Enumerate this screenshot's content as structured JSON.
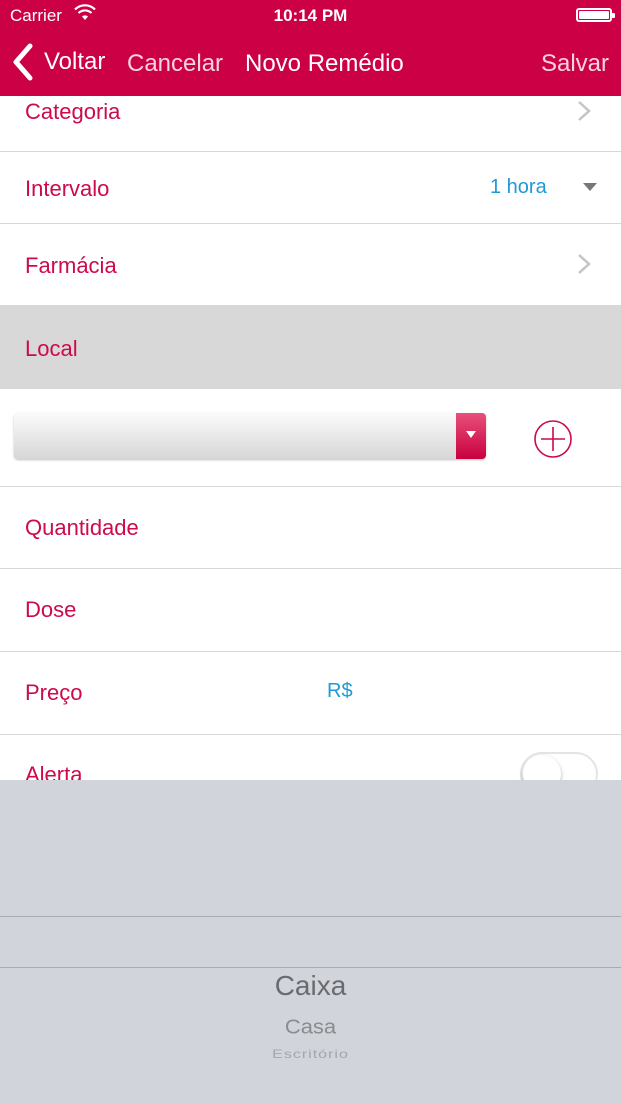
{
  "status_bar": {
    "carrier": "Carrier",
    "time": "10:14 PM"
  },
  "nav": {
    "back_label": "Voltar",
    "cancel_label": "Cancelar",
    "title": "Novo Remédio",
    "save_label": "Salvar"
  },
  "rows": {
    "categoria": {
      "label": "Categoria"
    },
    "intervalo": {
      "label": "Intervalo",
      "value": "1 hora"
    },
    "farmacia": {
      "label": "Farmácia"
    },
    "local": {
      "label": "Local"
    },
    "quantidade": {
      "label": "Quantidade"
    },
    "dose": {
      "label": "Dose"
    },
    "preco": {
      "label": "Preço",
      "value": "R$"
    },
    "alerta": {
      "label": "Alerta"
    }
  },
  "picker": {
    "options": [
      "Caixa",
      "Casa",
      "Escritório"
    ]
  },
  "colors": {
    "accent": "#cc0044",
    "label": "#cc0a4c",
    "value": "#1e9ad6",
    "picker_bg": "#d1d4da"
  }
}
